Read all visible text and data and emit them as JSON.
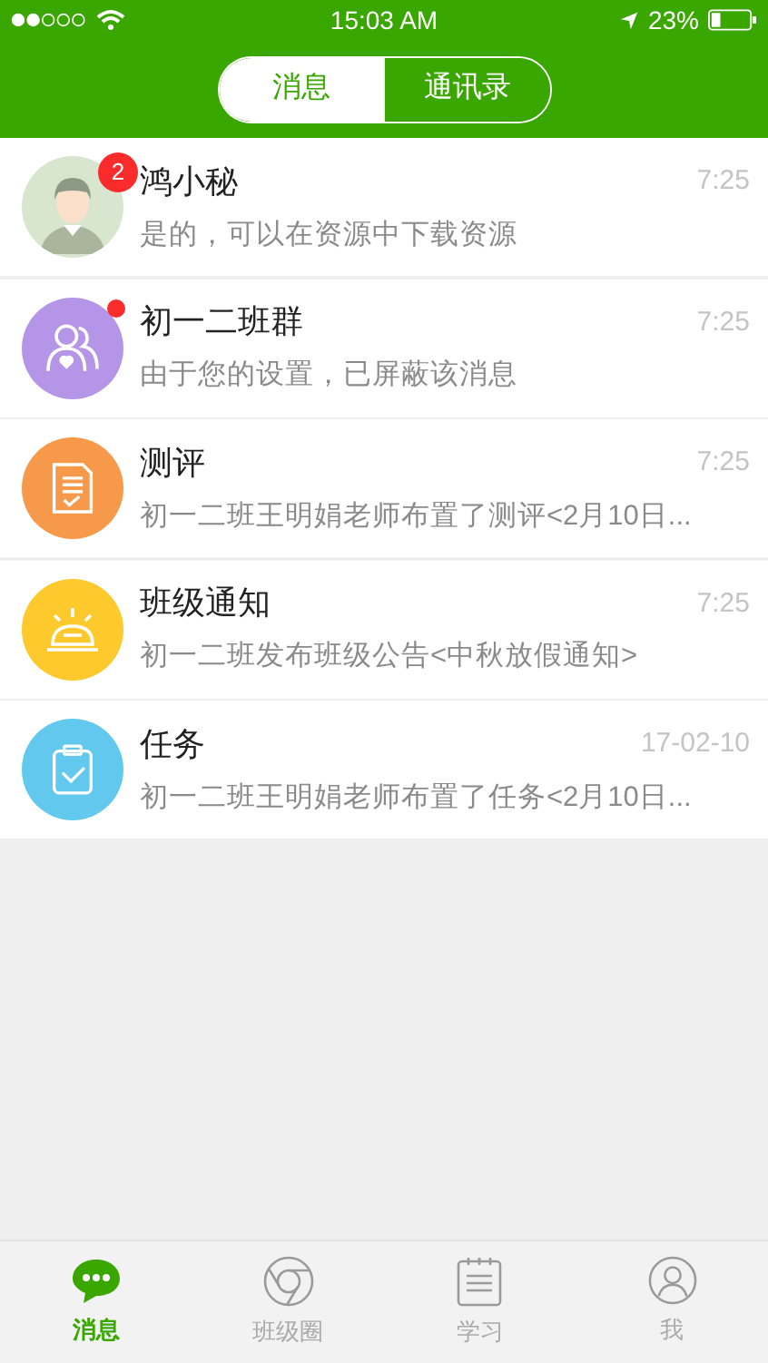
{
  "status_bar": {
    "time": "15:03 AM",
    "battery": "23%"
  },
  "segmented": [
    {
      "label": "消息",
      "selected": true
    },
    {
      "label": "通讯录",
      "selected": false
    }
  ],
  "conversations": [
    {
      "kind": "person",
      "name": "鸿小秘",
      "time": "7:25",
      "preview": "是的，可以在资源中下载资源",
      "badge": "2",
      "unread_dot": false
    },
    {
      "kind": "group",
      "name": "初一二班群",
      "time": "7:25",
      "preview": "由于您的设置，已屏蔽该消息",
      "unread_dot": true
    },
    {
      "kind": "report",
      "name": "测评",
      "time": "7:25",
      "preview": "初一二班王明娟老师布置了测评<2月10日...",
      "unread_dot": false
    },
    {
      "kind": "notice",
      "name": "班级通知",
      "time": "7:25",
      "preview": "初一二班发布班级公告<中秋放假通知>",
      "unread_dot": false
    },
    {
      "kind": "task",
      "name": "任务",
      "time": "17-02-10",
      "preview": "初一二班王明娟老师布置了任务<2月10日...",
      "unread_dot": false
    }
  ],
  "tab_bar": [
    {
      "kind": "chat",
      "label": "消息",
      "selected": true
    },
    {
      "kind": "circle",
      "label": "班级圈",
      "selected": false
    },
    {
      "kind": "study",
      "label": "学习",
      "selected": false
    },
    {
      "kind": "me",
      "label": "我",
      "selected": false
    }
  ]
}
